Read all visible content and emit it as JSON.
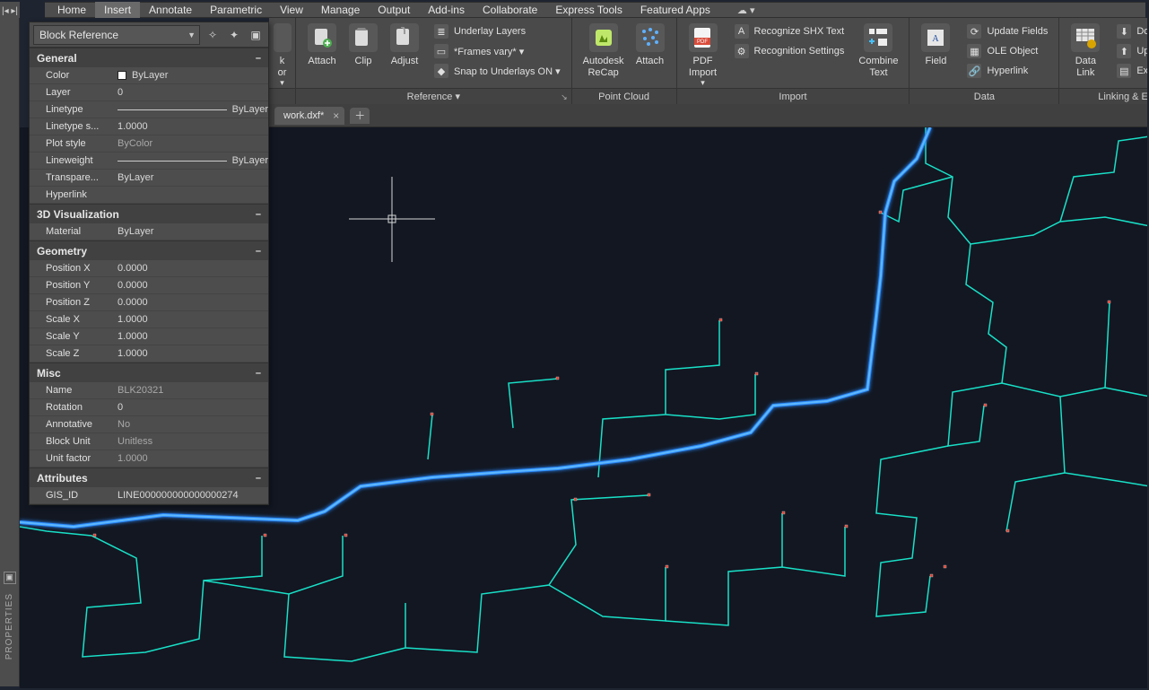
{
  "menu": {
    "items": [
      "Home",
      "Insert",
      "Annotate",
      "Parametric",
      "View",
      "Manage",
      "Output",
      "Add-ins",
      "Collaborate",
      "Express Tools",
      "Featured Apps"
    ],
    "active": "Insert",
    "cloud": "☁  ▾"
  },
  "sideRail": {
    "label": "PROPERTIES",
    "toggleGlyph": "|◂ ▸|"
  },
  "ribbon": {
    "truncatedBig": {
      "upper": "k",
      "lower": "or",
      "dd": "▾"
    },
    "attach": {
      "attach": "Attach",
      "clip": "Clip",
      "adjust": "Adjust"
    },
    "reference": {
      "title": "Reference ▾",
      "row1": "Underlay Layers",
      "row2": "*Frames vary* ▾",
      "row3": "Snap to Underlays ON ▾"
    },
    "pointCloud": {
      "title": "Point Cloud",
      "big1": "Autodesk\nReCap",
      "big2": "Attach"
    },
    "pdf": {
      "title": "Import",
      "label": "PDF\nImport",
      "dd": "▾"
    },
    "import": {
      "row1": "Recognize SHX Text",
      "row2": "Recognition Settings",
      "bigCombine": "Combine\nText"
    },
    "data": {
      "title": "Data",
      "field": "Field",
      "row1": "Update Fields",
      "row2": "OLE Object",
      "row3": "Hyperlink"
    },
    "linking": {
      "title": "Linking & Extraction",
      "dataLink": "Data\nLink",
      "row1": "Download from S",
      "row2": "Upload to Source",
      "row3": "Extract Data"
    }
  },
  "filetab": {
    "name": "work.dxf*"
  },
  "properties": {
    "selectorLabel": "Block Reference",
    "sections": {
      "general": {
        "title": "General",
        "rows": [
          {
            "k": "Color",
            "v": "ByLayer",
            "swatch": true
          },
          {
            "k": "Layer",
            "v": "0"
          },
          {
            "k": "Linetype",
            "v": "ByLayer",
            "line": true
          },
          {
            "k": "Linetype s...",
            "v": "1.0000"
          },
          {
            "k": "Plot style",
            "v": "ByColor",
            "dim": true
          },
          {
            "k": "Lineweight",
            "v": "ByLayer",
            "line": true
          },
          {
            "k": "Transpare...",
            "v": "ByLayer"
          },
          {
            "k": "Hyperlink",
            "v": ""
          }
        ]
      },
      "viz": {
        "title": "3D Visualization",
        "rows": [
          {
            "k": "Material",
            "v": "ByLayer"
          }
        ]
      },
      "geometry": {
        "title": "Geometry",
        "rows": [
          {
            "k": "Position X",
            "v": "0.0000"
          },
          {
            "k": "Position Y",
            "v": "0.0000"
          },
          {
            "k": "Position Z",
            "v": "0.0000"
          },
          {
            "k": "Scale X",
            "v": "1.0000"
          },
          {
            "k": "Scale Y",
            "v": "1.0000"
          },
          {
            "k": "Scale Z",
            "v": "1.0000"
          }
        ]
      },
      "misc": {
        "title": "Misc",
        "rows": [
          {
            "k": "Name",
            "v": "BLK20321",
            "dim": true
          },
          {
            "k": "Rotation",
            "v": "0"
          },
          {
            "k": "Annotative",
            "v": "No",
            "dim": true
          },
          {
            "k": "Block Unit",
            "v": "Unitless",
            "dim": true
          },
          {
            "k": "Unit factor",
            "v": "1.0000",
            "dim": true
          }
        ]
      },
      "attributes": {
        "title": "Attributes",
        "rows": [
          {
            "k": "GIS_ID",
            "v": "LINE000000000000000274"
          }
        ]
      }
    }
  }
}
